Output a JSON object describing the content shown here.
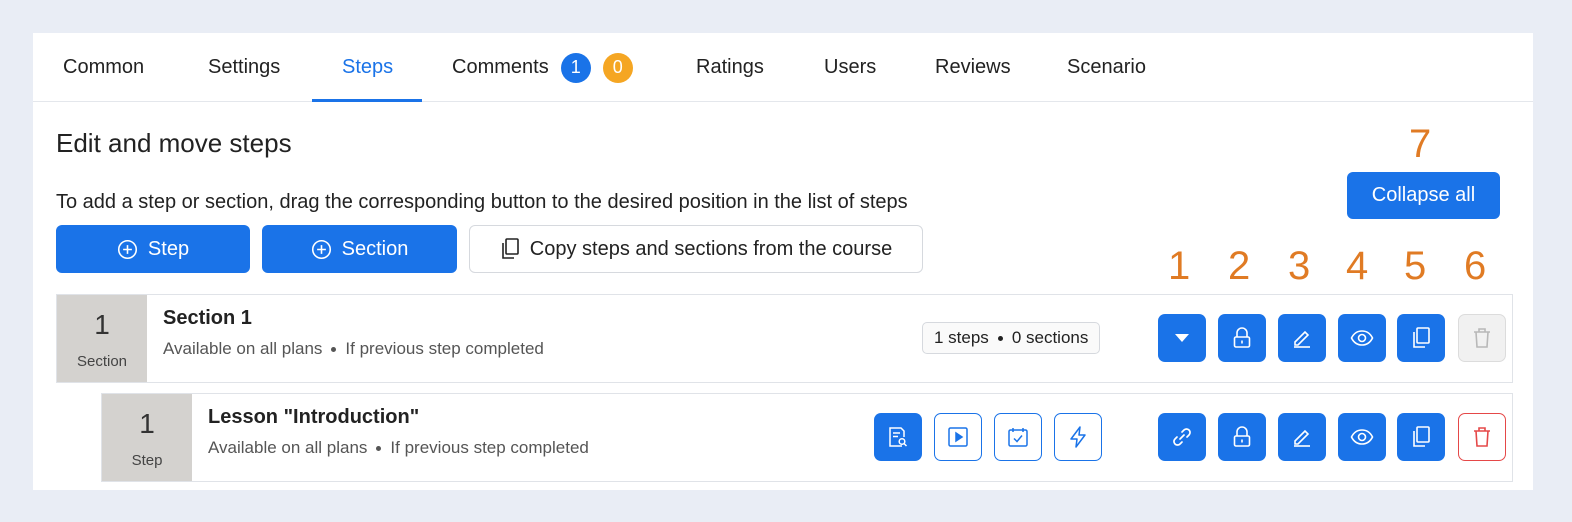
{
  "tabs": [
    {
      "label": "Common"
    },
    {
      "label": "Settings"
    },
    {
      "label": "Steps"
    },
    {
      "label": "Comments",
      "badge_blue": "1",
      "badge_orange": "0"
    },
    {
      "label": "Ratings"
    },
    {
      "label": "Users"
    },
    {
      "label": "Reviews"
    },
    {
      "label": "Scenario"
    }
  ],
  "active_tab": "Steps",
  "heading": "Edit and move steps",
  "instructions": "To add a step or section, drag the corresponding button to the desired position in the list of steps",
  "buttons": {
    "step": "Step",
    "section": "Section",
    "copy": "Copy steps and sections from the course",
    "collapse_all": "Collapse all"
  },
  "annotations": [
    "1",
    "2",
    "3",
    "4",
    "5",
    "6",
    "7"
  ],
  "section_row": {
    "number": "1",
    "kind": "Section",
    "title": "Section 1",
    "availability": "Available on all plans",
    "condition": "If previous step completed",
    "steps_count": "1 steps",
    "sections_count": "0 sections"
  },
  "step_row": {
    "number": "1",
    "kind": "Step",
    "title": "Lesson \"Introduction\"",
    "availability": "Available on all plans",
    "condition": "If previous step completed"
  },
  "colors": {
    "accent": "#1a73e8",
    "annotation": "#e07b24",
    "badge_orange": "#f5a623",
    "danger": "#e54848"
  }
}
